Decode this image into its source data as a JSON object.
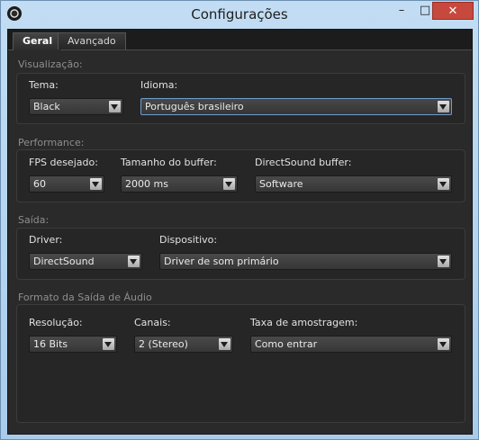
{
  "window": {
    "title": "Configurações",
    "minimize": "–",
    "maximize": "□",
    "close": "✕"
  },
  "tabs": [
    {
      "label": "Geral",
      "active": true
    },
    {
      "label": "Avançado",
      "active": false
    }
  ],
  "visualizacao": {
    "title": "Visualização:",
    "tema_label": "Tema:",
    "tema_value": "Black",
    "idioma_label": "Idioma:",
    "idioma_value": "Português brasileiro"
  },
  "performance": {
    "title": "Performance:",
    "fps_label": "FPS desejado:",
    "fps_value": "60",
    "buffer_label": "Tamanho do buffer:",
    "buffer_value": "2000 ms",
    "dsbuffer_label": "DirectSound buffer:",
    "dsbuffer_value": "Software"
  },
  "saida": {
    "title": "Saída:",
    "driver_label": "Driver:",
    "driver_value": "DirectSound",
    "dispositivo_label": "Dispositivo:",
    "dispositivo_value": "Driver de som primário"
  },
  "formato": {
    "title": "Formato da Saída de Áudio",
    "resolucao_label": "Resolução:",
    "resolucao_value": "16 Bits",
    "canais_label": "Canais:",
    "canais_value": "2 (Stereo)",
    "taxa_label": "Taxa de amostragem:",
    "taxa_value": "Como entrar"
  },
  "colors": {
    "background": "#2a2a2a",
    "titlebar": "#b5d5ef",
    "close": "#c7483c",
    "focus": "#6f9cd0"
  }
}
